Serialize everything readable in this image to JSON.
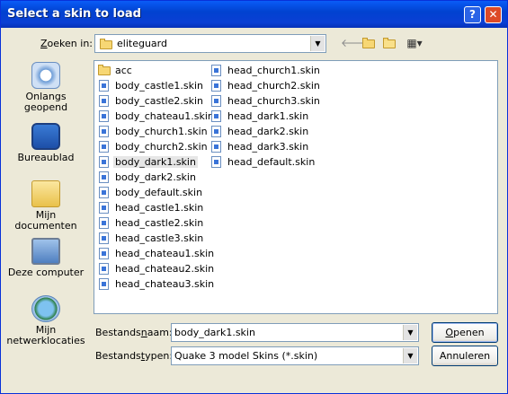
{
  "window": {
    "title": "Select a skin to load",
    "help_glyph": "?",
    "close_glyph": "✕"
  },
  "lookin": {
    "label_accel": "Z",
    "label_rest": "oeken in:",
    "value": "eliteguard"
  },
  "toolbar": {
    "back": "back-arrow-icon",
    "up": "up-folder-icon",
    "new": "new-folder-icon",
    "views": "views-menu-icon"
  },
  "places": [
    {
      "label": "Onlangs geopend",
      "icon": "recent-documents-icon"
    },
    {
      "label": "Bureaublad",
      "icon": "desktop-icon"
    },
    {
      "label": "Mijn documenten",
      "icon": "my-documents-icon"
    },
    {
      "label": "Deze computer",
      "icon": "my-computer-icon"
    },
    {
      "label": "Mijn netwerklocaties",
      "icon": "network-places-icon"
    }
  ],
  "files": {
    "col1": [
      "acc",
      "body_castle1.skin",
      "body_castle2.skin",
      "body_chateau1.skin",
      "body_church1.skin",
      "body_church2.skin",
      "body_dark1.skin",
      "body_dark2.skin",
      "body_default.skin",
      "head_castle1.skin",
      "head_castle2.skin",
      "head_castle3.skin",
      "head_chateau1.skin",
      "head_chateau2.skin",
      "head_chateau3.skin"
    ],
    "col2": [
      "head_church1.skin",
      "head_church2.skin",
      "head_church3.skin",
      "head_dark1.skin",
      "head_dark2.skin",
      "head_dark3.skin",
      "head_default.skin"
    ],
    "selected": "body_dark1.skin"
  },
  "filename": {
    "label_pre": "Bestands",
    "label_accel": "n",
    "label_post": "aam:",
    "value": "body_dark1.skin"
  },
  "filetype": {
    "label_pre": "Bestands",
    "label_accel": "t",
    "label_post": "ypen:",
    "value": "Quake 3 model Skins  (*.skin)"
  },
  "buttons": {
    "open_accel": "O",
    "open_rest": "penen",
    "cancel": "Annuleren"
  }
}
